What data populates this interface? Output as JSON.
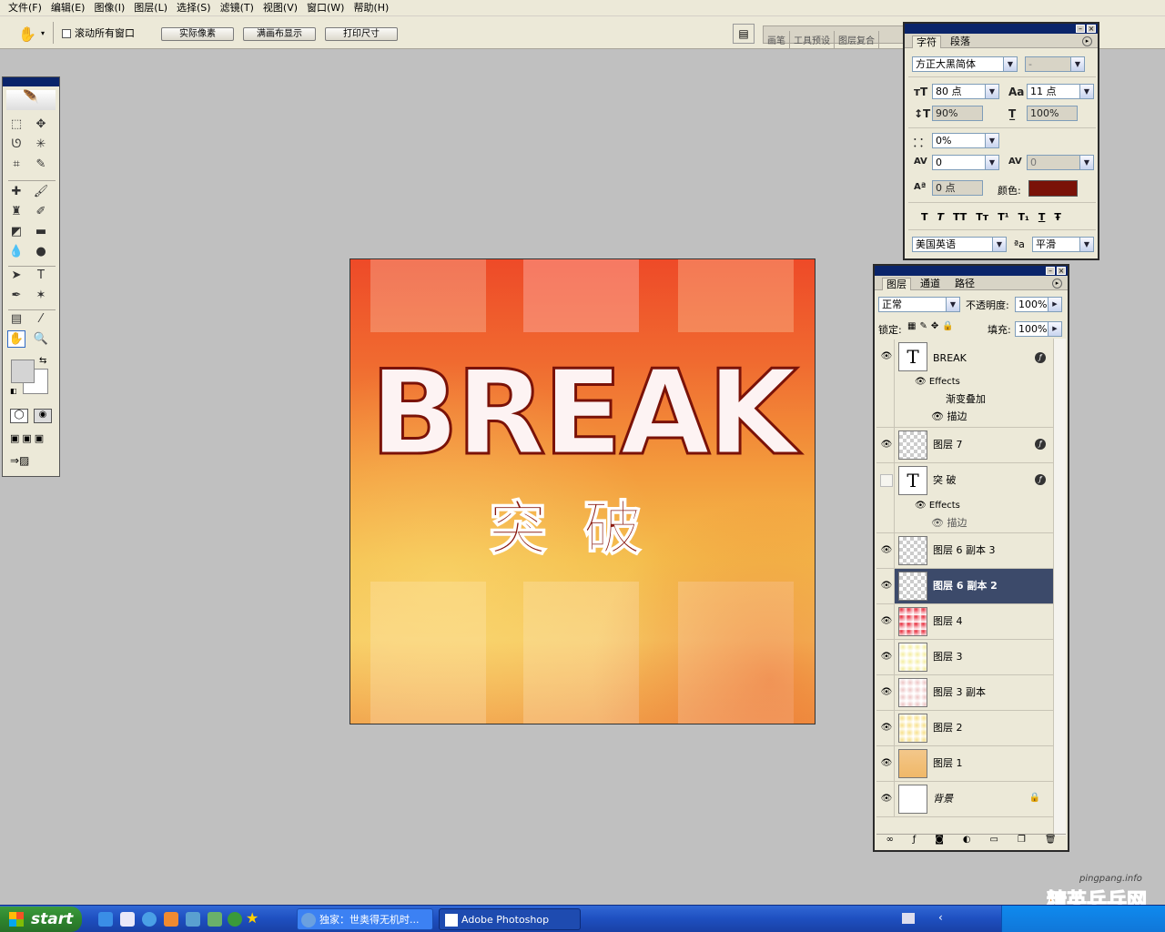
{
  "menubar": {
    "items": [
      "文件(F)",
      "编辑(E)",
      "图像(I)",
      "图层(L)",
      "选择(S)",
      "滤镜(T)",
      "视图(V)",
      "窗口(W)",
      "帮助(H)"
    ]
  },
  "options": {
    "tool_icon": "hand-icon",
    "scroll_all_label": "滚动所有窗口",
    "scroll_all_checked": false,
    "actual_pixels": "实际像素",
    "fit_screen": "满画布显示",
    "print_size": "打印尺寸"
  },
  "well_tabs": [
    "画笔",
    "工具预设",
    "图层复合"
  ],
  "canvas": {
    "title_text": "BREAK",
    "subtitle_text": "突破"
  },
  "character_panel": {
    "tabs": [
      "字符",
      "段落"
    ],
    "font_family": "方正大黑简体",
    "font_style": "-",
    "size": "80 点",
    "leading": "11 点",
    "vscale": "90%",
    "hscale": "100%",
    "tsume": "0%",
    "kerning": "0",
    "tracking": "0",
    "baseline": "0 点",
    "color_label": "颜色:",
    "color": "#7a1208",
    "style_buttons": [
      "T",
      "T",
      "TT",
      "Tт",
      "T¹",
      "T₁",
      "T",
      "Ŧ"
    ],
    "language": "美国英语",
    "aa_label": "ªa",
    "antialias": "平滑"
  },
  "layers_panel": {
    "tabs": [
      "图层",
      "通道",
      "路径"
    ],
    "blend_mode": "正常",
    "opacity_label": "不透明度:",
    "opacity": "100%",
    "lock_label": "锁定:",
    "fill_label": "填充:",
    "fill": "100%",
    "layers": [
      {
        "name": "BREAK",
        "type": "text",
        "visible": true,
        "fx": true,
        "effects_label": "Effects",
        "effects": [
          "渐变叠加",
          "描边"
        ]
      },
      {
        "name": "图层 7",
        "type": "raster",
        "visible": true,
        "fx": true
      },
      {
        "name": "突 破",
        "type": "text",
        "visible": false,
        "fx": true,
        "effects_label": "Effects",
        "effects": [
          "描边"
        ]
      },
      {
        "name": "图层 6 副本 3",
        "type": "raster",
        "visible": true
      },
      {
        "name": "图层 6 副本 2",
        "type": "raster",
        "visible": true,
        "selected": true
      },
      {
        "name": "图层 4",
        "type": "raster",
        "visible": true
      },
      {
        "name": "图层 3",
        "type": "raster",
        "visible": true
      },
      {
        "name": "图层 3 副本",
        "type": "raster",
        "visible": true
      },
      {
        "name": "图层 2",
        "type": "raster",
        "visible": true
      },
      {
        "name": "图层 1",
        "type": "raster",
        "visible": true
      },
      {
        "name": "背景",
        "type": "background",
        "visible": true,
        "locked": true
      }
    ]
  },
  "taskbar": {
    "start": "start",
    "tasks": [
      "独家：世奥得无机时...",
      "Adobe Photoshop"
    ],
    "active_task": "Adobe Photoshop"
  },
  "watermark": {
    "site": "pingpang.info",
    "brand": "精英乒乓网"
  },
  "colors": {
    "accent_selected": "#3c4a6a",
    "title_bar": "#0a246a",
    "panel_bg": "#ece9d8"
  }
}
